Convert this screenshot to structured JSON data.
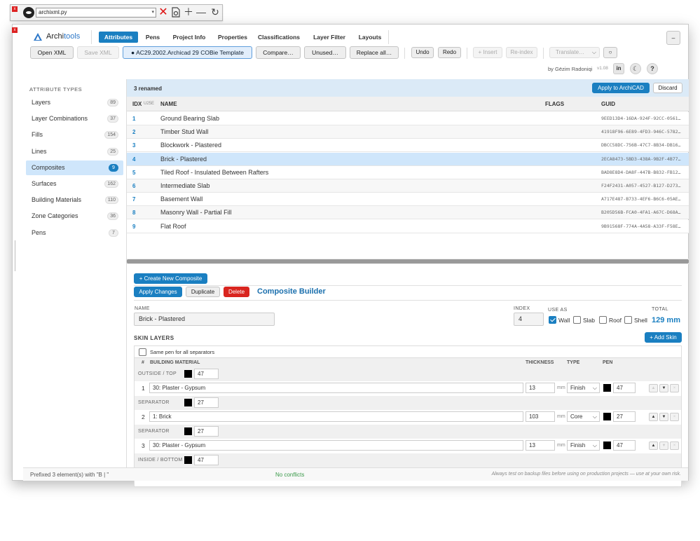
{
  "toolbar": {
    "close_label": "x",
    "file_select": "archixml.py",
    "select_caret": "▾"
  },
  "app": {
    "close_label": "x",
    "brand_part1": "Archi",
    "brand_part2": "tools",
    "tabs": [
      {
        "label": "Attributes",
        "active": true
      },
      {
        "label": "Pens"
      },
      {
        "label": "Project Info"
      },
      {
        "label": "Properties"
      },
      {
        "label": "Classifications"
      },
      {
        "label": "Layer Filter"
      },
      {
        "label": "Layouts"
      }
    ],
    "minimize_label": "–",
    "actions": {
      "open_xml": "Open XML",
      "save_xml": "Save XML",
      "template": "● AC29.2002.Archicad 29 COBie Template",
      "compare": "Compare…",
      "unused": "Unused…",
      "replace_all": "Replace all…",
      "undo": "Undo",
      "redo": "Redo",
      "insert": "+ Insert",
      "reindex": "Re-index",
      "translate": "Translate…",
      "translate_caret": "⌵",
      "small_circle": "○"
    },
    "author": "by Gëzim Radoniqi",
    "version": "v1.08",
    "icons": {
      "linkedin": "in",
      "moon": "☾",
      "help": "?"
    }
  },
  "sidebar": {
    "title": "ATTRIBUTE TYPES",
    "items": [
      {
        "label": "Layers",
        "count": "89"
      },
      {
        "label": "Layer Combinations",
        "count": "37"
      },
      {
        "label": "Fills",
        "count": "154"
      },
      {
        "label": "Lines",
        "count": "25"
      },
      {
        "label": "Composites",
        "count": "9",
        "active": true
      },
      {
        "label": "Surfaces",
        "count": "162"
      },
      {
        "label": "Building Materials",
        "count": "110"
      },
      {
        "label": "Zone Categories",
        "count": "36"
      },
      {
        "label": "Pens",
        "count": "7"
      }
    ]
  },
  "rename": {
    "text": "3 renamed",
    "apply": "Apply to ArchiCAD",
    "discard": "Discard"
  },
  "table": {
    "headers": {
      "idx": "IDX",
      "sort": "U25E",
      "name": "NAME",
      "flags": "FLAGS",
      "guid": "GUID"
    },
    "rows": [
      {
        "idx": "1",
        "name": "Ground Bearing Slab",
        "guid": "9EED13D4-16DA-924F-92CC-0561…"
      },
      {
        "idx": "2",
        "name": "Timber Stud Wall",
        "guid": "41918F96-6E89-4FD3-946C-5782…"
      },
      {
        "idx": "3",
        "name": "Blockwork - Plastered",
        "guid": "DBCC58DC-756B-47C7-8B34-DB16…"
      },
      {
        "idx": "4",
        "name": "Brick - Plastered",
        "guid": "2ECA8473-5BD3-438A-9B2F-4B77…",
        "selected": true
      },
      {
        "idx": "5",
        "name": "Tiled Roof - Insulated Between Rafters",
        "guid": "BAD8E8D4-DA8F-447B-B832-FB12…"
      },
      {
        "idx": "6",
        "name": "Intermediate Slab",
        "guid": "F24F2431-A057-4527-B127-D273…"
      },
      {
        "idx": "7",
        "name": "Basement Wall",
        "guid": "A717E487-B733-4EF6-B6C6-05AE…"
      },
      {
        "idx": "8",
        "name": "Masonry Wall - Partial Fill",
        "guid": "B205D56B-FCA0-4FA1-A67C-D68A…"
      },
      {
        "idx": "9",
        "name": "Flat Roof",
        "guid": "9B91568F-774A-4A58-A33F-F58E…"
      }
    ]
  },
  "builder": {
    "create": "+ Create New Composite",
    "apply": "Apply Changes",
    "duplicate": "Duplicate",
    "delete": "Delete",
    "title": "Composite Builder",
    "name_label": "NAME",
    "name_value": "Brick - Plastered",
    "index_label": "INDEX",
    "index_value": "4",
    "use_as_label": "USE AS",
    "use_as": [
      {
        "label": "Wall",
        "checked": true
      },
      {
        "label": "Slab"
      },
      {
        "label": "Roof"
      },
      {
        "label": "Shell"
      }
    ],
    "total_label": "TOTAL",
    "total_value": "129 mm",
    "skin_layers_label": "SKIN LAYERS",
    "add_skin": "+ Add Skin",
    "same_pen": "Same pen for all separators",
    "skin_headers": {
      "num": "#",
      "material": "BUILDING MATERIAL",
      "thickness": "THICKNESS",
      "type": "TYPE",
      "pen": "PEN"
    },
    "outside": {
      "label": "OUTSIDE / TOP",
      "pen": "47"
    },
    "skins": [
      {
        "num": "1",
        "material": "30: Plaster - Gypsum",
        "thickness": "13",
        "unit": "mm",
        "type": "Finish",
        "pen": "47"
      },
      {
        "num": "2",
        "material": "1: Brick",
        "thickness": "103",
        "unit": "mm",
        "type": "Core",
        "pen": "27"
      },
      {
        "num": "3",
        "material": "30: Plaster - Gypsum",
        "thickness": "13",
        "unit": "mm",
        "type": "Finish",
        "pen": "47"
      }
    ],
    "separators": [
      {
        "label": "SEPARATOR",
        "pen": "27"
      },
      {
        "label": "SEPARATOR",
        "pen": "27"
      }
    ],
    "inside": {
      "label": "INSIDE / BOTTOM",
      "pen": "47"
    },
    "arrows": {
      "up": "▲",
      "down": "▼",
      "del": "×",
      "caret": "⌵"
    }
  },
  "status": {
    "left": "Prefixed 3 element(s) with \"B | \"",
    "center": "No conflicts",
    "right": "Always test on backup files before using on production projects — use at your own risk."
  }
}
